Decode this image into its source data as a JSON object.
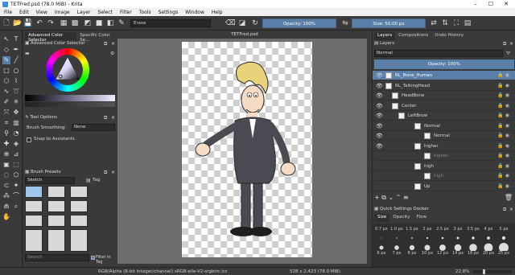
{
  "window": {
    "title": "TETFred.psd (78.0 MiB) - Krita",
    "minimize": "–",
    "maximize": "☐",
    "close": "✕"
  },
  "menu": [
    "File",
    "Edit",
    "View",
    "Image",
    "Layer",
    "Select",
    "Filter",
    "Tools",
    "Settings",
    "Window",
    "Help"
  ],
  "toolbar": {
    "blend_mode": "Erase",
    "opacity_label": "Opacity: 100%",
    "size_label": "Size: 50.00 px"
  },
  "left_dock": {
    "tabs": [
      "Advanced Color Selector",
      "Specific Color Se..."
    ],
    "color_selector_title": "Advanced Color Selector",
    "tool_options_title": "Tool Options",
    "brush_smoothing_label": "Brush Smoothing:",
    "brush_smoothing_value": "None",
    "snap_label": "Snap to Assistants",
    "brush_presets_title": "Brush Presets",
    "preset_filter": "Sketch",
    "tag_label": "Tag",
    "search_placeholder": "Search",
    "filter_in_tag": "Filter in Tag"
  },
  "canvas": {
    "doc_tab": "TETFred.psd"
  },
  "right_dock": {
    "tabs": [
      "Layers",
      "Compositions",
      "Undo History"
    ],
    "layers_title": "Layers",
    "blend_mode": "Normal",
    "opacity_label": "Opacity: 100%",
    "layers": [
      {
        "name": "RL_Bone_Human",
        "indent": 0,
        "selected": true
      },
      {
        "name": "RL_TalkingHead",
        "indent": 0,
        "selected": false
      },
      {
        "name": "HeadBone",
        "indent": 1,
        "selected": false
      },
      {
        "name": "Center",
        "indent": 1,
        "selected": false
      },
      {
        "name": "LeftBrow",
        "indent": 2,
        "selected": false
      },
      {
        "name": "Normal",
        "indent": 3,
        "selected": false
      },
      {
        "name": "Normal",
        "indent": 4,
        "selected": false
      },
      {
        "name": "higher",
        "indent": 3,
        "selected": false
      },
      {
        "name": "higher",
        "indent": 4,
        "selected": false
      },
      {
        "name": "high",
        "indent": 3,
        "selected": false
      },
      {
        "name": "high",
        "indent": 4,
        "selected": false
      },
      {
        "name": "Up",
        "indent": 3,
        "selected": false
      }
    ],
    "quick_settings_title": "Quick Settings Docker",
    "quick_tabs": [
      "Size",
      "Opacity",
      "Flow"
    ],
    "sizes_row1": [
      "0.7 px",
      "1.0 px",
      "1.5 px",
      "2 px",
      "2.5 px",
      "3 px",
      "3.5 px",
      "4 px",
      "5 px"
    ],
    "sizes_row2": [
      "6 px",
      "7 px",
      "8 px",
      "10 px",
      "12 px",
      "14 px",
      "16 px",
      "20 px",
      "25 px"
    ]
  },
  "status": {
    "color_space": "RGB/Alpha (8-bit integer/channel)  sRGB-elle-V2-srgbtrc.icc",
    "dimensions": "528 x 2,423 (78.0 MiB)",
    "zoom": "22.8%"
  },
  "colors": {
    "accent": "#5a7fa8",
    "panel": "#3a3a3a",
    "canvas_bg": "#6e6e6e"
  }
}
